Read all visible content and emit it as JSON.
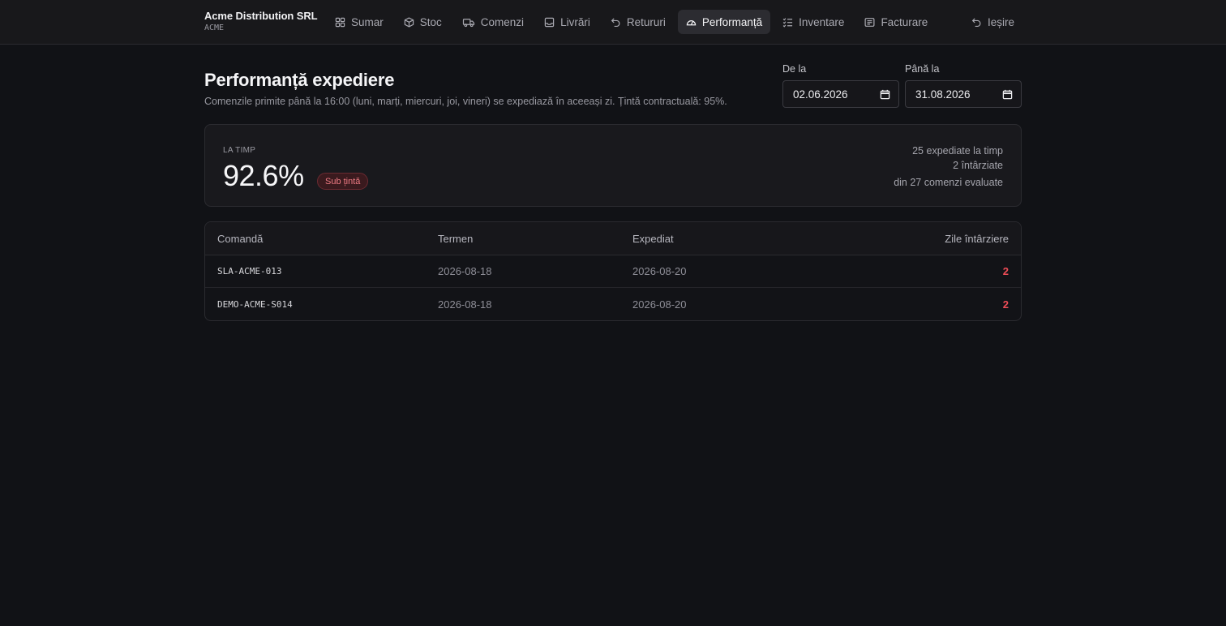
{
  "brand": {
    "name": "Acme Distribution SRL",
    "code": "ACME"
  },
  "nav": {
    "items": [
      {
        "label": "Sumar",
        "icon": "grid-icon"
      },
      {
        "label": "Stoc",
        "icon": "cube-icon"
      },
      {
        "label": "Comenzi",
        "icon": "truck-icon"
      },
      {
        "label": "Livrări",
        "icon": "inbox-icon"
      },
      {
        "label": "Retururi",
        "icon": "undo-icon"
      },
      {
        "label": "Performanță",
        "icon": "gauge-icon",
        "active": true
      },
      {
        "label": "Inventare",
        "icon": "checklist-icon"
      },
      {
        "label": "Facturare",
        "icon": "receipt-icon"
      }
    ],
    "logout_label": "Ieșire"
  },
  "header": {
    "title": "Performanță expediere",
    "subtitle": "Comenzile primite până la 16:00 (luni, marți, miercuri, joi, vineri) se expediază în aceeași zi. Țintă contractuală: 95%."
  },
  "filters": {
    "from": {
      "label": "De la",
      "value": "02.06.2026"
    },
    "to": {
      "label": "Până la",
      "value": "31.08.2026"
    }
  },
  "kpi": {
    "label": "LA TIMP",
    "value": "92.6%",
    "badge": "Sub țintă",
    "on_time": "25 expediate la timp",
    "late": "2 întârziate",
    "evaluated": "din 27 comenzi evaluate"
  },
  "table": {
    "columns": [
      "Comandă",
      "Termen",
      "Expediat",
      "Zile întârziere"
    ],
    "rows": [
      {
        "order": "SLA-ACME-013",
        "due": "2026-08-18",
        "shipped": "2026-08-20",
        "days_late": "2"
      },
      {
        "order": "DEMO-ACME-S014",
        "due": "2026-08-18",
        "shipped": "2026-08-20",
        "days_late": "2"
      }
    ]
  },
  "colors": {
    "background": "#111216",
    "late": "#ef4d57",
    "badge": "#ef7b84"
  }
}
